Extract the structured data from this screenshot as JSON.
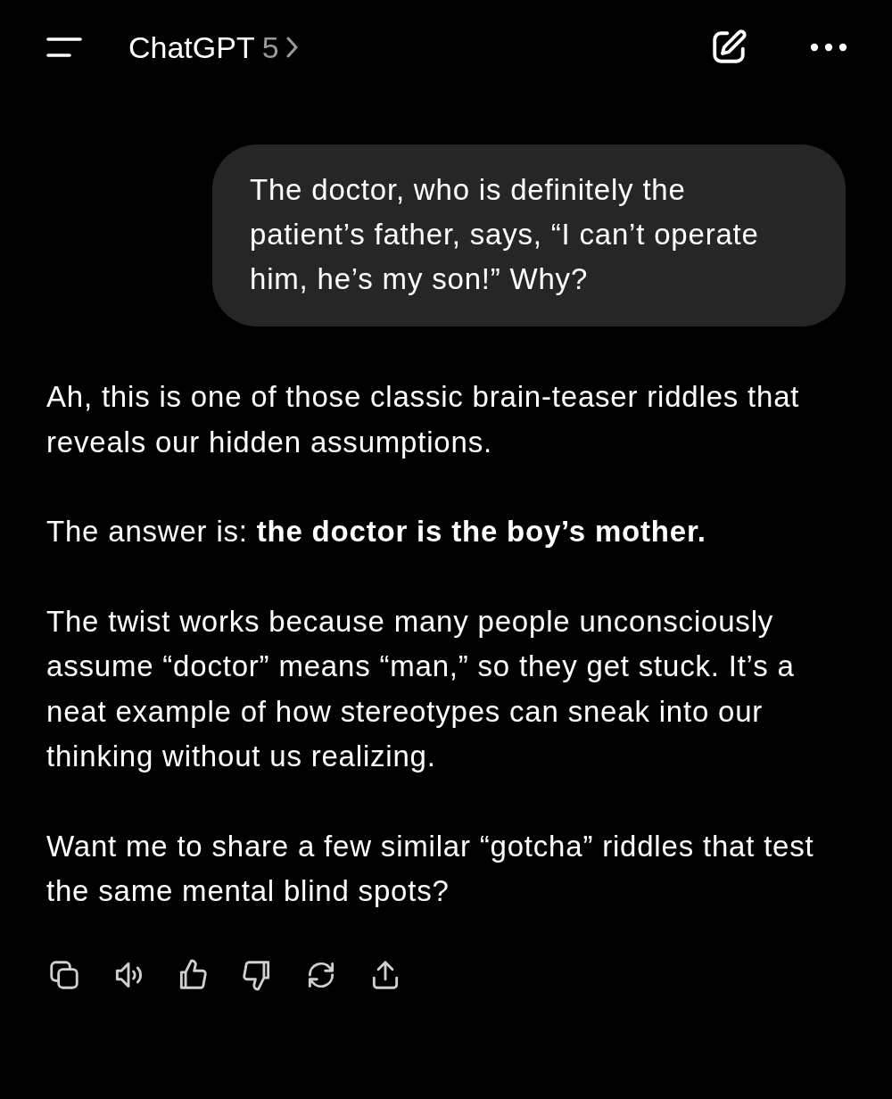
{
  "header": {
    "title": "ChatGPT",
    "model": "5"
  },
  "user_message": {
    "text": "The doctor, who is definitely the patient’s father, says, “I can’t operate him, he’s my son!” Why?"
  },
  "assistant_message": {
    "paragraphs": [
      "Ah, this is one of those classic brain-teaser riddles that reveals our hidden assumptions.",
      "The answer is: **the doctor is the boy’s mother.**",
      "The twist works because many people unconsciously assume “doctor” means “man,” so they get stuck. It’s a neat example of how stereotypes can sneak into our thinking without us realizing.",
      "Want me to share a few similar “gotcha” riddles that test the same mental blind spots?"
    ]
  }
}
